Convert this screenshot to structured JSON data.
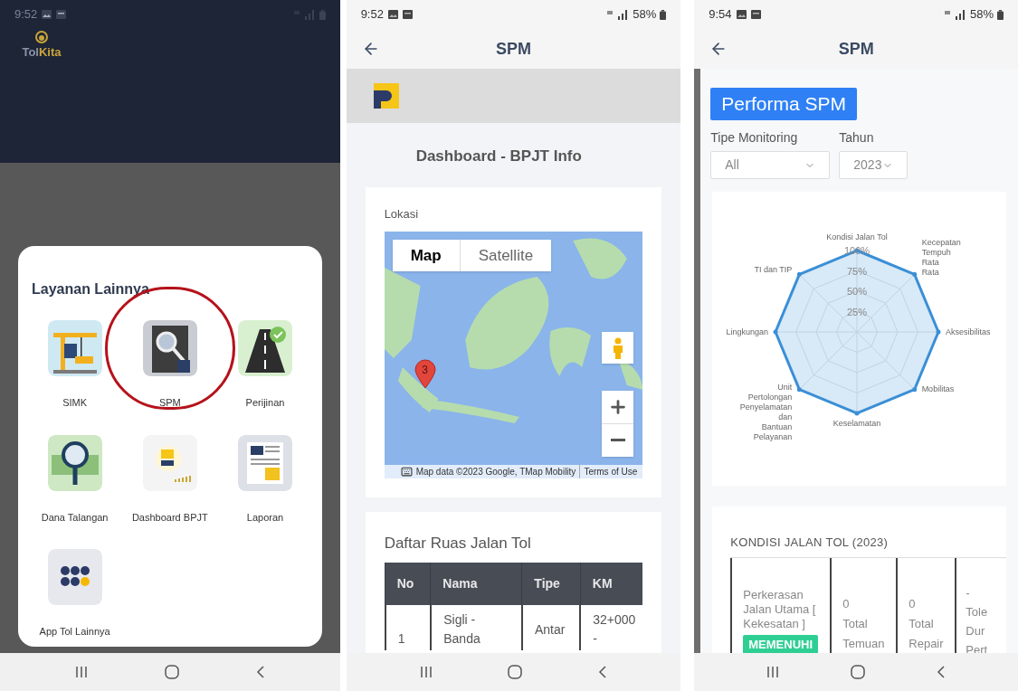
{
  "menu_screen": {
    "status_bar": {
      "time": "9:52"
    },
    "logo": {
      "part_1": "Tol",
      "part_2": "Kita"
    },
    "sheet": {
      "title": "Layanan Lainnya",
      "items": [
        {
          "label": "SIMK",
          "kind": "crane",
          "circled": false
        },
        {
          "label": "SPM",
          "kind": "magnifier",
          "circled": true
        },
        {
          "label": "Perijinan",
          "kind": "road",
          "circled": false
        },
        {
          "label": "Dana Talangan",
          "kind": "money",
          "circled": false
        },
        {
          "label": "Dashboard BPJT",
          "kind": "dashboard",
          "circled": false
        },
        {
          "label": "Laporan",
          "kind": "report",
          "circled": false
        },
        {
          "label": "App Tol Lainnya",
          "kind": "apps",
          "circled": false
        }
      ]
    }
  },
  "dashboard_screen": {
    "status_bar": {
      "time": "9:52",
      "battery": "58%"
    },
    "header": {
      "title": "SPM"
    },
    "page_title": "Dashboard - BPJT Info",
    "location_card": {
      "title": "Lokasi",
      "map": {
        "map_type_buttons": [
          {
            "label": "Map",
            "selected": true
          },
          {
            "label": "Satellite",
            "selected": false
          }
        ],
        "marker": "3",
        "attribution": "Map data ©2023 Google, TMap Mobility",
        "terms_link": "Terms of Use"
      }
    },
    "roads_card": {
      "title": "Daftar Ruas Jalan Tol",
      "columns": [
        "No",
        "Nama",
        "Tipe",
        "KM"
      ],
      "rows": [
        [
          "1",
          "Sigli - Banda",
          "Antar",
          "32+000 -"
        ]
      ]
    }
  },
  "performa_screen": {
    "status_bar": {
      "time": "9:54",
      "battery": "58%"
    },
    "header": {
      "title": "SPM"
    },
    "badge": "Performa SPM",
    "filters": [
      {
        "label": "Tipe Monitoring",
        "value": "All"
      },
      {
        "label": "Tahun",
        "value": "2023"
      }
    ],
    "radar_chart": {
      "axis_labels": [
        {
          "text": "Kondisi Jalan Tol",
          "kind": "top"
        },
        {
          "text": "TI dan TIP",
          "kind": "topleft"
        },
        {
          "text": "Kecepatan Tempuh Rata Rata",
          "kind": "topright"
        },
        {
          "text": "Lingkungan",
          "kind": "left"
        },
        {
          "text": "Aksesibilitas",
          "kind": "right"
        },
        {
          "text": "Unit Pertolongan Penyelamatan dan Bantuan Pelayanan",
          "kind": "bottomleft"
        },
        {
          "text": "Mobilitas",
          "kind": "bottomright"
        },
        {
          "text": "Keselamatan",
          "kind": "bottom"
        }
      ],
      "tick_labels": [
        "100%",
        "75%",
        "50%",
        "25%"
      ]
    },
    "condition_table": {
      "title": "KONDISI JALAN TOL (2023)",
      "rows": [
        {
          "item": "Perkerasan Jalan Utama [ Kekesatan ]",
          "status": "MEMENUHI",
          "temuan_count": "0",
          "temuan_label": "Total Temuan",
          "repair_count": "0",
          "repair_label": "Total Repair",
          "column_4": [
            "-",
            "Tole",
            "Dur",
            "Pert"
          ]
        }
      ]
    }
  }
}
